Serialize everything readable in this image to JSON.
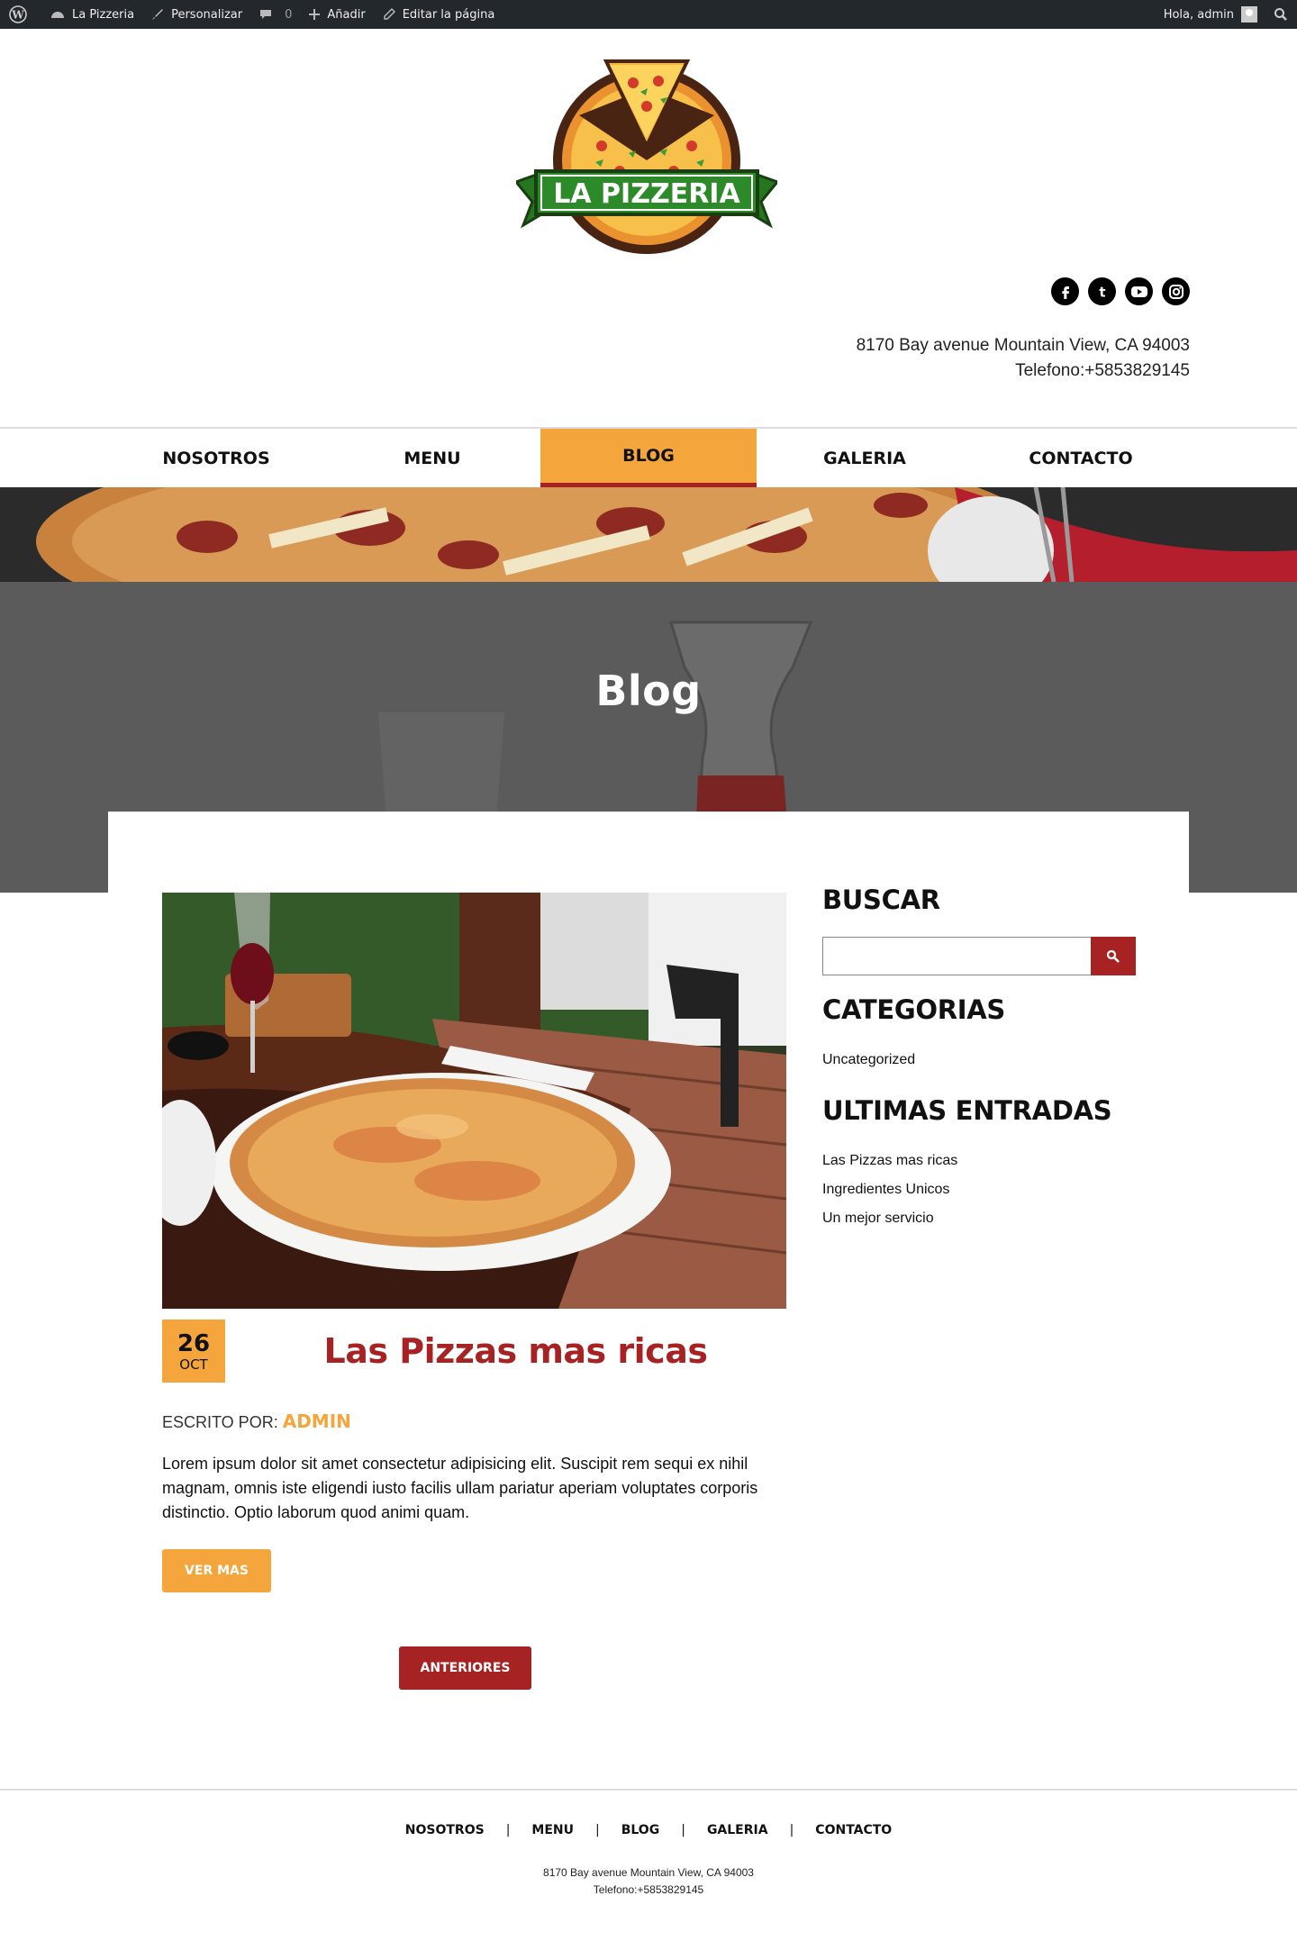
{
  "adminbar": {
    "site_name": "La Pizzeria",
    "customize": "Personalizar",
    "comments_count": "0",
    "add_new": "Añadir",
    "edit_page": "Editar la página",
    "greeting": "Hola, admin"
  },
  "header": {
    "logo_text": "LA PIZZERIA",
    "address_line": "8170 Bay avenue Mountain View, CA 94003",
    "phone_line": "Telefono:+5853829145",
    "social": [
      "facebook-icon",
      "tumblr-icon",
      "youtube-icon",
      "instagram-icon"
    ]
  },
  "nav": {
    "items": [
      "NOSOTROS",
      "MENU",
      "BLOG",
      "GALERIA",
      "CONTACTO"
    ],
    "active": "BLOG"
  },
  "hero": {
    "title": "Blog"
  },
  "post": {
    "day": "26",
    "month": "OCT",
    "title": "Las Pizzas mas ricas",
    "byline_prefix": "ESCRITO POR:",
    "author": "ADMIN",
    "excerpt": "Lorem ipsum dolor sit amet consectetur adipisicing elit. Suscipit rem sequi ex nihil magnam, omnis iste eligendi iusto facilis ullam pariatur aperiam voluptates corporis distinctio. Optio laborum quod animi quam.",
    "more_button": "VER MAS"
  },
  "pagination": {
    "previous_button": "ANTERIORES"
  },
  "sidebar": {
    "search_title": "BUSCAR",
    "search_value": "",
    "categories_title": "CATEGORIAS",
    "categories": [
      "Uncategorized"
    ],
    "recent_title": "ULTIMAS ENTRADAS",
    "recent": [
      "Las Pizzas mas ricas",
      "Ingredientes Unicos",
      "Un mejor servicio"
    ]
  },
  "footer": {
    "nav": [
      "NOSOTROS",
      "MENU",
      "BLOG",
      "GALERIA",
      "CONTACTO"
    ],
    "separator": "|",
    "address_line": "8170 Bay avenue Mountain View, CA 94003",
    "phone_line": "Telefono:+5853829145"
  },
  "colors": {
    "accent": "#f4a53c",
    "brand_red": "#a72323",
    "adminbar": "#23282d"
  }
}
